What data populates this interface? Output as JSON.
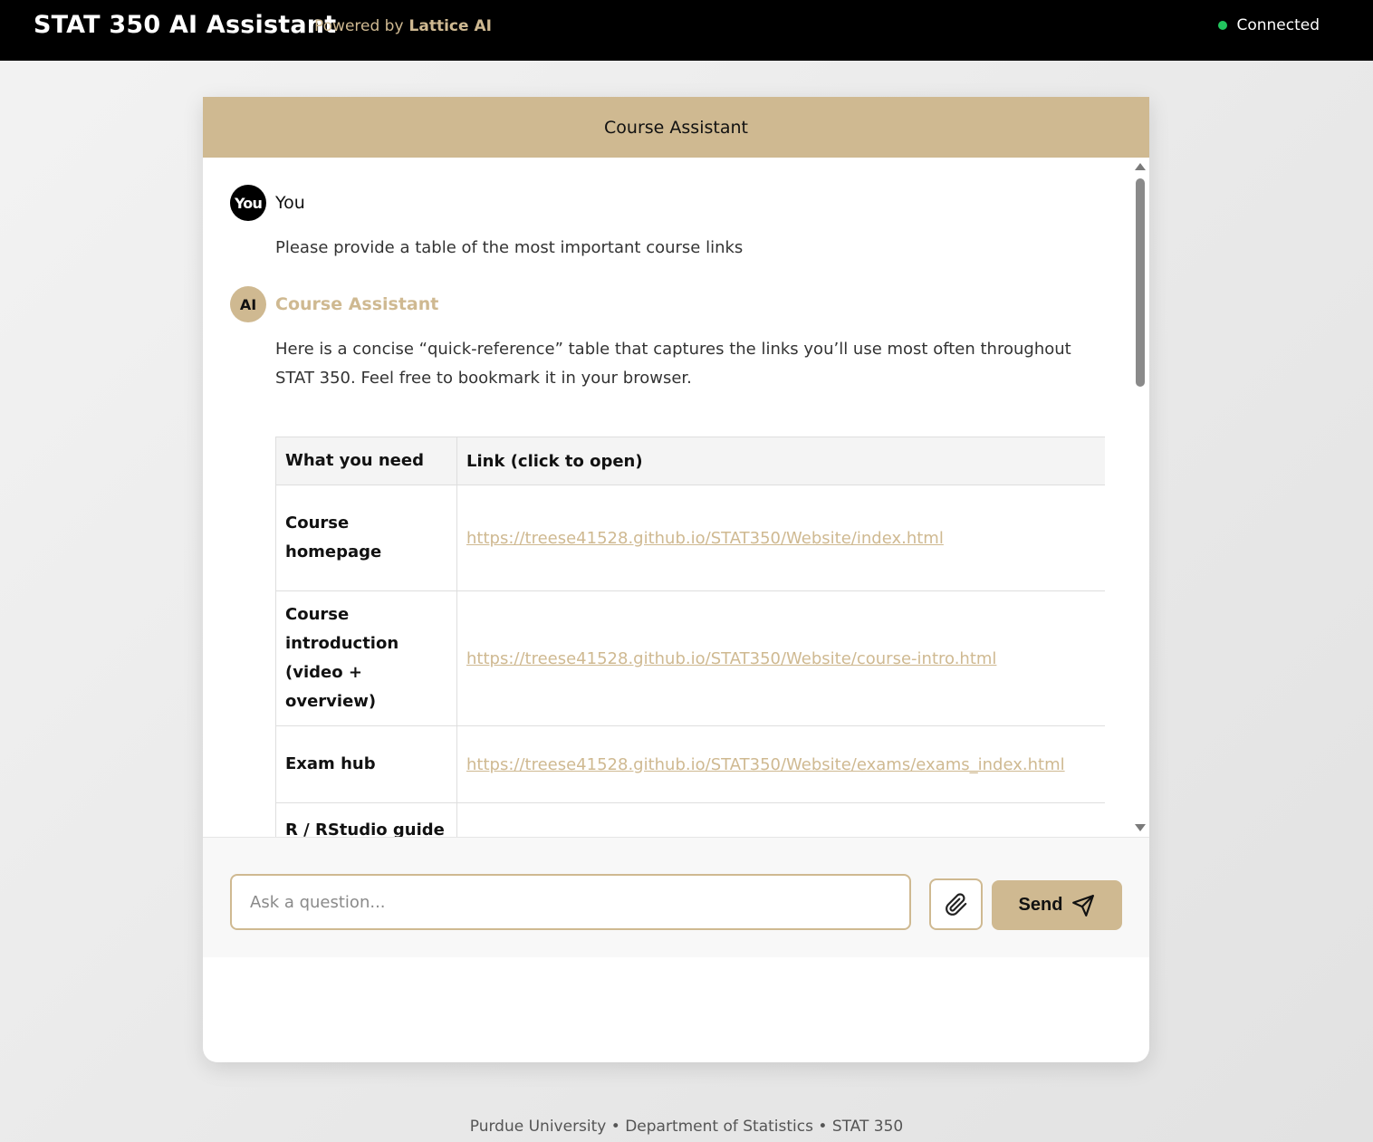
{
  "header": {
    "app_title": "STAT 350 AI Assistant",
    "powered_by_label": "Powered by",
    "powered_by_brand": "Lattice AI",
    "status_text": "Connected",
    "status_color": "#22c55e"
  },
  "chat": {
    "title": "Course Assistant",
    "messages": [
      {
        "avatar": "You",
        "sender": "You",
        "text": "Please provide a table of the most important course links"
      },
      {
        "avatar": "AI",
        "sender": "Course Assistant",
        "text": "Here is a concise “quick-reference” table that captures the links you’ll use most often throughout STAT 350. Feel free to bookmark it in your browser."
      }
    ],
    "table": {
      "headers": [
        "What you need",
        "Link (click to open)"
      ],
      "rows": [
        {
          "need": "Course homepage",
          "link": "https://treese41528.github.io/STAT350/Website/index.html"
        },
        {
          "need": "Course introduction (video + overview)",
          "link": "https://treese41528.github.io/STAT350/Website/course-intro.html"
        },
        {
          "need": "Exam hub",
          "link": "https://treese41528.github.io/STAT350/Website/exams/exams_index.html"
        },
        {
          "need": "R / RStudio guide",
          "link": ""
        }
      ]
    }
  },
  "composer": {
    "placeholder": "Ask a question...",
    "value": "",
    "attach_icon": "paperclip-icon",
    "send_label": "Send",
    "send_icon": "send-icon"
  },
  "footer": {
    "text": "Purdue University • Department of Statistics • STAT 350"
  },
  "colors": {
    "accent": "#cfb991",
    "topbar": "#000000"
  }
}
